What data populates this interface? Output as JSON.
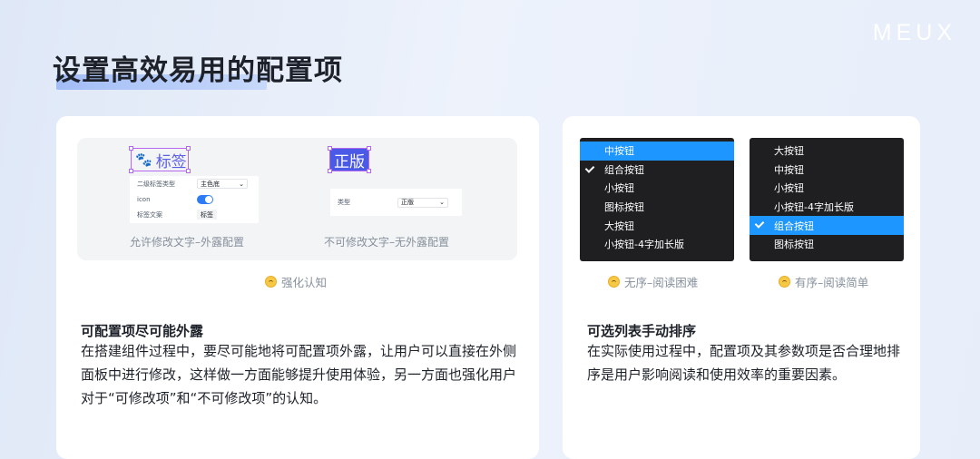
{
  "brand": {
    "logo": "MEUX"
  },
  "page": {
    "title": "设置高效易用的配置项"
  },
  "left_card": {
    "demo_a": {
      "tag_label": "标签",
      "rows": [
        {
          "key": "二级标签类型",
          "value": "主色底"
        },
        {
          "key": "icon",
          "value": ""
        },
        {
          "key": "标签文案",
          "value": "标签"
        }
      ],
      "caption": "允许修改文字–外露配置"
    },
    "demo_b": {
      "tag_label": "正版",
      "rows": [
        {
          "key": "类型",
          "value": "正版"
        }
      ],
      "caption": "不可修改文字–无外露配置"
    },
    "emoji_caption": "强化认知",
    "section_title": "可配置项尽可能外露",
    "section_body": "在搭建组件过程中，要尽可能地将可配置项外露，让用户可以直接在外侧面板中进行修改，这样做一方面能够提升使用体验，另一方面也强化用户对于“可修改项”和“不可修改项”的认知。"
  },
  "right_card": {
    "list_unordered": {
      "items": [
        {
          "label": "中按钮",
          "active": true,
          "checked": false
        },
        {
          "label": "组合按钮",
          "active": false,
          "checked": true
        },
        {
          "label": "小按钮",
          "active": false,
          "checked": false
        },
        {
          "label": "图标按钮",
          "active": false,
          "checked": false
        },
        {
          "label": "大按钮",
          "active": false,
          "checked": false
        },
        {
          "label": "小按钮-4字加长版",
          "active": false,
          "checked": false
        }
      ],
      "caption": "无序–阅读困难"
    },
    "list_ordered": {
      "items": [
        {
          "label": "大按钮",
          "active": false,
          "checked": false
        },
        {
          "label": "中按钮",
          "active": false,
          "checked": false
        },
        {
          "label": "小按钮",
          "active": false,
          "checked": false
        },
        {
          "label": "小按钮-4字加长版",
          "active": false,
          "checked": false
        },
        {
          "label": "组合按钮",
          "active": true,
          "checked": true
        },
        {
          "label": "图标按钮",
          "active": false,
          "checked": false
        }
      ],
      "caption": "有序–阅读简单"
    },
    "section_title": "可选列表手动排序",
    "section_body": "在实际使用过程中，配置项及其参数项是否合理地排序是用户影响阅读和使用效率的重要因素。"
  },
  "colors": {
    "accent_blue": "#1d96ff",
    "tag_blue": "#4a59e6",
    "selection_purple": "#b667f0",
    "dark_menu": "#1f1f22"
  }
}
